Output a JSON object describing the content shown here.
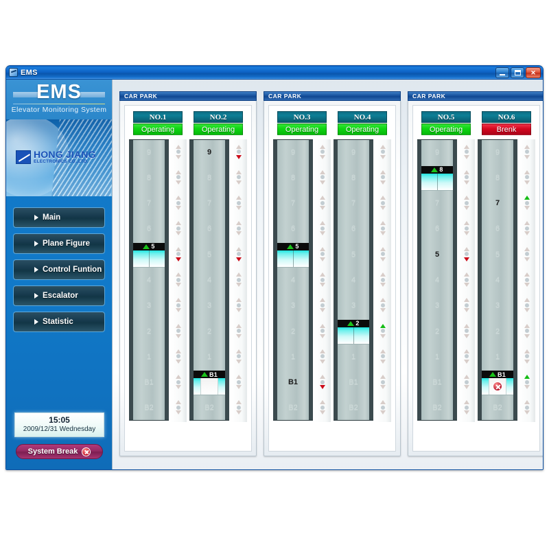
{
  "window": {
    "title": "EMS",
    "icon": "app-icon",
    "buttons": {
      "minimize": "minimize",
      "maximize": "maximize",
      "close": "close"
    }
  },
  "brand": {
    "title": "EMS",
    "subtitle": "Elevator Monitoring System",
    "company_name": "HONG JIANG",
    "company_sub": "ELECTRONICS CO.,LTD."
  },
  "sidebar": {
    "items": [
      {
        "label": "Main"
      },
      {
        "label": "Plane Figure"
      },
      {
        "label": "Control Funtion"
      },
      {
        "label": "Escalator"
      },
      {
        "label": "Statistic"
      }
    ],
    "clock": {
      "time": "15:05",
      "date": "2009/12/31 Wednesday"
    },
    "system_break": {
      "label": "System Break",
      "icon": "error-x-icon"
    }
  },
  "floors": [
    "9",
    "8",
    "7",
    "6",
    "5",
    "4",
    "3",
    "2",
    "1",
    "B1",
    "B2"
  ],
  "colors": {
    "status_ok": "#10d714",
    "status_fail": "#d6071f",
    "call_up_active": "#14bc14",
    "call_down_active": "#cc0d1b",
    "title_blue": "#0f4791",
    "sidebar_blue": "#1179c8",
    "accent_magenta": "#942a62"
  },
  "groups": [
    {
      "title": "CAR PARK",
      "elevators": [
        {
          "name": "NO.1",
          "status": "Operating",
          "status_state": "ok",
          "car_floor": "5",
          "car_direction": "up",
          "doors": "closed",
          "error": false,
          "active_floor": null,
          "calls": {
            "5": "down"
          }
        },
        {
          "name": "NO.2",
          "status": "Operating",
          "status_state": "ok",
          "car_floor": "B1",
          "car_direction": "up",
          "doors": "open",
          "error": false,
          "active_floor": "9",
          "calls": {
            "9": "down",
            "5": "down"
          }
        }
      ]
    },
    {
      "title": "CAR PARK",
      "elevators": [
        {
          "name": "NO.3",
          "status": "Operating",
          "status_state": "ok",
          "car_floor": "5",
          "car_direction": "up",
          "doors": "closed",
          "error": false,
          "active_floor": "B1",
          "calls": {
            "B1": "down"
          }
        },
        {
          "name": "NO.4",
          "status": "Operating",
          "status_state": "ok",
          "car_floor": "2",
          "car_direction": "up",
          "doors": "closed",
          "error": false,
          "active_floor": null,
          "calls": {
            "2": "up"
          }
        }
      ]
    },
    {
      "title": "CAR PARK",
      "elevators": [
        {
          "name": "NO.5",
          "status": "Operating",
          "status_state": "ok",
          "car_floor": "8",
          "car_direction": "up",
          "doors": "closed",
          "error": false,
          "active_floor": "5",
          "calls": {
            "5": "down"
          }
        },
        {
          "name": "NO.6",
          "status": "Brenk",
          "status_state": "fail",
          "car_floor": "B1",
          "car_direction": "up",
          "doors": "open",
          "error": true,
          "active_floor": "7",
          "calls": {
            "7": "up",
            "B1": "up"
          }
        }
      ]
    }
  ]
}
